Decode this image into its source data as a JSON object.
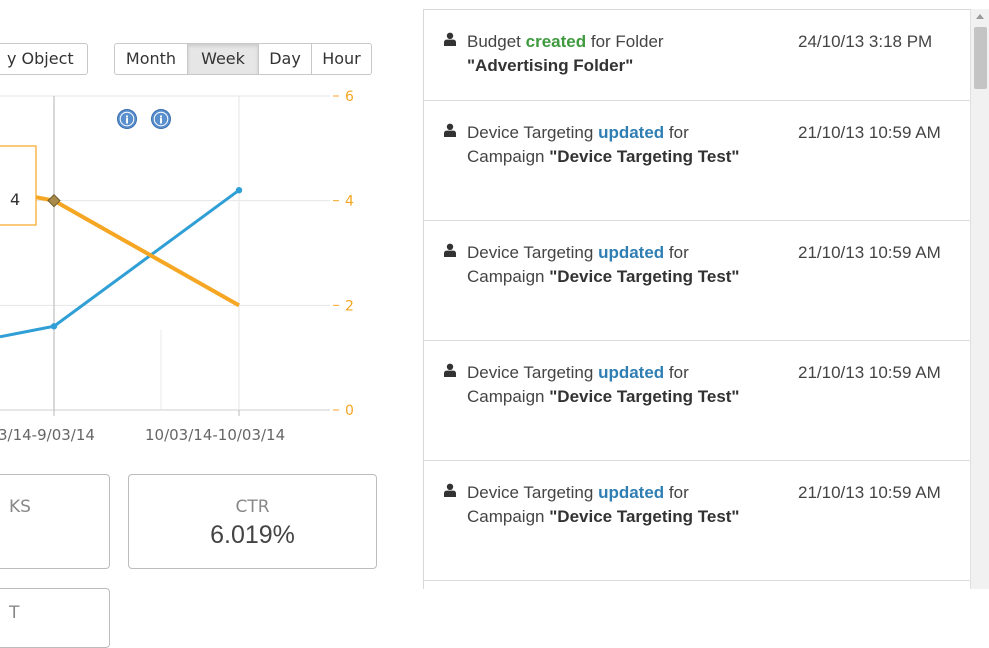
{
  "toolbar": {
    "group_by_label": "y Object",
    "range_options": [
      {
        "label": "Month",
        "active": false
      },
      {
        "label": "Week",
        "active": true
      },
      {
        "label": "Day",
        "active": false
      },
      {
        "label": "Hour",
        "active": false
      }
    ]
  },
  "chart_data": {
    "type": "line",
    "categories": [
      "3/14-9/03/14",
      "10/03/14-10/03/14"
    ],
    "x_tick_labels": [
      "3/14-9/03/14",
      "10/03/14-10/03/14"
    ],
    "series": [
      {
        "color": "#2f9fd6",
        "axis": "left",
        "points": [
          {
            "x": "",
            "y": 1.4
          },
          {
            "x": "3/14-9/03/14",
            "y": 1.6
          },
          {
            "x": "10/03/14-10/03/14",
            "y": 4.2
          }
        ]
      },
      {
        "color": "#f5a623",
        "axis": "right",
        "points": [
          {
            "x": "",
            "y": 4.2
          },
          {
            "x": "3/14-9/03/14",
            "y": 4
          },
          {
            "x": "10/03/14-10/03/14",
            "y": 2
          }
        ]
      }
    ],
    "right_axis": {
      "ticks": [
        "0",
        "2",
        "4",
        "6"
      ],
      "ylim": [
        0,
        6
      ],
      "color": "#f5a623"
    },
    "tooltip_value": "4",
    "info_icons": 2,
    "grid": true
  },
  "kpis": [
    {
      "label": "KS",
      "value": ""
    },
    {
      "label": "CTR",
      "value": "6.019%"
    },
    {
      "label": "T",
      "value": ""
    }
  ],
  "activity": [
    {
      "subject": "Budget",
      "action": "created",
      "preposition": "for Folder",
      "target": "\"Advertising Folder\"",
      "time": "24/10/13 3:18 PM"
    },
    {
      "subject": "Device Targeting",
      "action": "updated",
      "preposition": "for Campaign",
      "target": "\"Device Targeting Test\"",
      "time": "21/10/13 10:59 AM"
    },
    {
      "subject": "Device Targeting",
      "action": "updated",
      "preposition": "for Campaign",
      "target": "\"Device Targeting Test\"",
      "time": "21/10/13 10:59 AM"
    },
    {
      "subject": "Device Targeting",
      "action": "updated",
      "preposition": "for Campaign",
      "target": "\"Device Targeting Test\"",
      "time": "21/10/13 10:59 AM"
    },
    {
      "subject": "Device Targeting",
      "action": "updated",
      "preposition": "for Campaign",
      "target": "\"Device Targeting Test\"",
      "time": "21/10/13 10:59 AM"
    }
  ],
  "colors": {
    "created": "#3f9a3f",
    "updated": "#2f7fb4",
    "accent_orange": "#f5a623",
    "accent_blue": "#2f9fd6"
  }
}
